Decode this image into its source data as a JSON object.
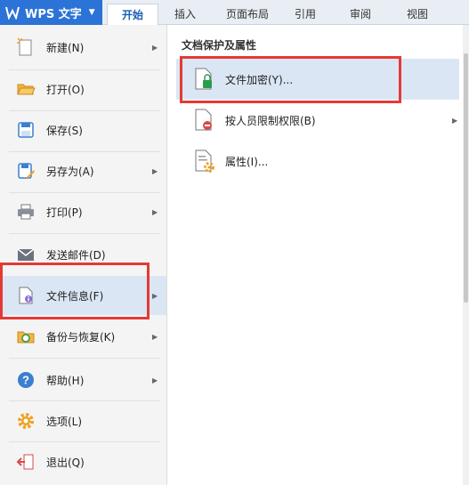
{
  "app": {
    "title": "WPS 文字",
    "caret": "▼",
    "brand_color": "#2b73d6"
  },
  "tabs": [
    {
      "label": "开始",
      "active": true
    },
    {
      "label": "插入",
      "active": false
    },
    {
      "label": "页面布局",
      "active": false
    },
    {
      "label": "引用",
      "active": false
    },
    {
      "label": "审阅",
      "active": false
    },
    {
      "label": "视图",
      "active": false
    }
  ],
  "menu": {
    "items": [
      {
        "label": "新建(N)",
        "icon": "new-document-icon",
        "submenu": true
      },
      {
        "label": "打开(O)",
        "icon": "folder-open-icon",
        "submenu": false
      },
      {
        "label": "保存(S)",
        "icon": "save-disk-icon",
        "submenu": false
      },
      {
        "label": "另存为(A)",
        "icon": "save-as-icon",
        "submenu": true
      },
      {
        "label": "打印(P)",
        "icon": "printer-icon",
        "submenu": true
      },
      {
        "label": "发送邮件(D)",
        "icon": "mail-icon",
        "submenu": false
      },
      {
        "label": "文件信息(F)",
        "icon": "file-info-icon",
        "submenu": true,
        "selected": true
      },
      {
        "label": "备份与恢复(K)",
        "icon": "backup-restore-icon",
        "submenu": true
      },
      {
        "label": "帮助(H)",
        "icon": "help-icon",
        "submenu": true
      },
      {
        "label": "选项(L)",
        "icon": "gear-icon",
        "submenu": false
      },
      {
        "label": "退出(Q)",
        "icon": "exit-icon",
        "submenu": false
      }
    ],
    "arrow": "▶"
  },
  "panel": {
    "title": "文档保护及属性",
    "items": [
      {
        "label": "文件加密(Y)...",
        "icon": "file-lock-icon",
        "submenu": false,
        "hover": true
      },
      {
        "label": "按人员限制权限(B)",
        "icon": "file-restrict-icon",
        "submenu": true
      },
      {
        "label": "属性(I)...",
        "icon": "file-properties-icon",
        "submenu": false
      }
    ]
  },
  "colors": {
    "selected_bg": "#dbe6f4",
    "highlight_red": "#e53935",
    "accent_blue": "#1a5fb4"
  }
}
